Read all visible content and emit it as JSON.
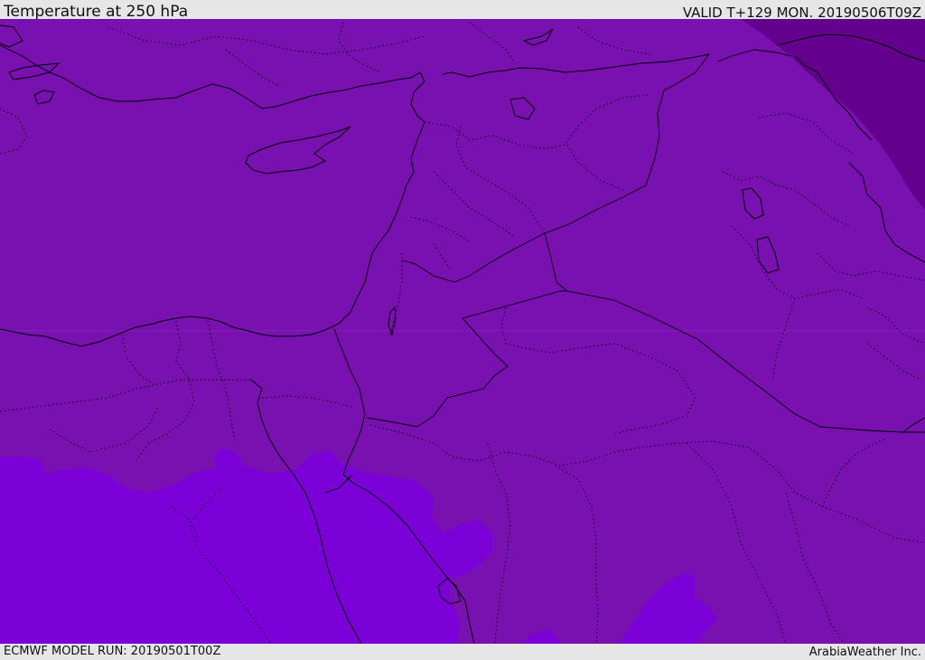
{
  "header": {
    "title": "Temperature at 250 hPa",
    "valid_time": "VALID T+129 MON. 20190506T09Z"
  },
  "footer": {
    "model_run": "ECMWF MODEL RUN: 20190501T00Z",
    "credit": "ArabiaWeather Inc."
  },
  "colors": {
    "main_field": "#7910b0",
    "warm_field": "#7b00d8",
    "cold_field": "#64008e",
    "coastline": "#000000",
    "bar_background": "#e6e6e6"
  }
}
